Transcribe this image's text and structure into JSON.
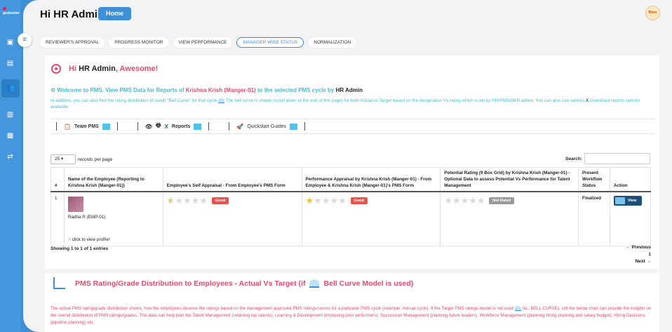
{
  "app": {
    "logo_text": "goalsetter"
  },
  "header": {
    "greeting": "Hi HR Admin",
    "home_label": "Home",
    "avatar_text": "Mors"
  },
  "tabs": [
    {
      "label": "REVIEWER'S APPROVAL"
    },
    {
      "label": "PROGRESS MONITOR"
    },
    {
      "label": "VIEW PERFORMANCE"
    },
    {
      "label": "MANAGER WISE STATUS"
    },
    {
      "label": "NORMALIZATION"
    }
  ],
  "intro": {
    "hi": "Hi",
    "name": "HR Admin",
    "awesome": ", Awesome!",
    "welcome_pre": "Welcome to PMS. View PMS Data for Reports of",
    "manager": "Krishna Krish (Manger-01)",
    "welcome_mid": "to the selected PMS cycle by",
    "by": "HR Admin",
    "info_1": "In addition, you can also find the rating distribution (if used) \"Bell Curve\" for that cycle",
    "info_2": "The bell curve is shown (scroll down at the end of this page) for both Actual vs Target based on the designation Vs rating which is set by HR/PMS/OKR admin. You can also use various",
    "info_3": "Download reports options available."
  },
  "toolbar": {
    "team_pms": "Team PMS",
    "reports": "Reports",
    "quickstart": "Quickstart Guides"
  },
  "table": {
    "length_value": "25",
    "length_suffix": "records per page",
    "search_label": "Search:",
    "headers": [
      "#",
      "Name of the Employee (Reporting to Krishna Krish (Manger-01))",
      "Employee's Self Appraisal - From Employee's PMS Form",
      "Performance Appraisal by Krishna Krish (Manger-01) - From Employee & Krishna Krish (Manger-01)'s PMS Form",
      "Potential Rating (9 Box Grid) by Krishna Krish (Manger-01) - Optional Data to assess Potential Vs Performance for Talent Management",
      "Present Workflow Status",
      "Action"
    ],
    "row": {
      "index": "1",
      "employee": "Radha R (EMP-01)",
      "click_profile": "click to view profile!",
      "self_stars": 0.5,
      "self_badge": "Good",
      "mgr_stars": 1,
      "mgr_badge": "Good",
      "pot_stars": 0,
      "pot_badge": "Not Rated",
      "status": "Finalized",
      "action": "View"
    },
    "showing": "Showing 1 to 1 of 1 entries",
    "prev": "← Previous",
    "page": "1",
    "next": "Next →"
  },
  "distribution": {
    "title_pre": "PMS Rating/Grade Distribution to Employees - Actual Vs Target (if",
    "title_post": "Bell Curve Model is used)",
    "text_1": "The actual PMS rating/grade distribution shows, how the employees deserve the ratings based on the management approved PMS ratings/scores for a particular PMS cycle (example: Annual cycle). If the Target PMS ratings model is not used",
    "text_2": "(ie., BELL CURVE); still the below chart can provide the insights on the overall distribution of PMS ratings/grades. This data can help plan the Talent Management (retaining top talents), Learning & Development (improving poor performers), Succession Management (planning future leaders), Workforce Management (planning hiring planning and salary budget), Hiring Decisions (pipeline planning) etc."
  },
  "colors": {
    "accent": "#3f8fd6",
    "pink": "#e64a6f",
    "teal": "#4ab8d0"
  }
}
